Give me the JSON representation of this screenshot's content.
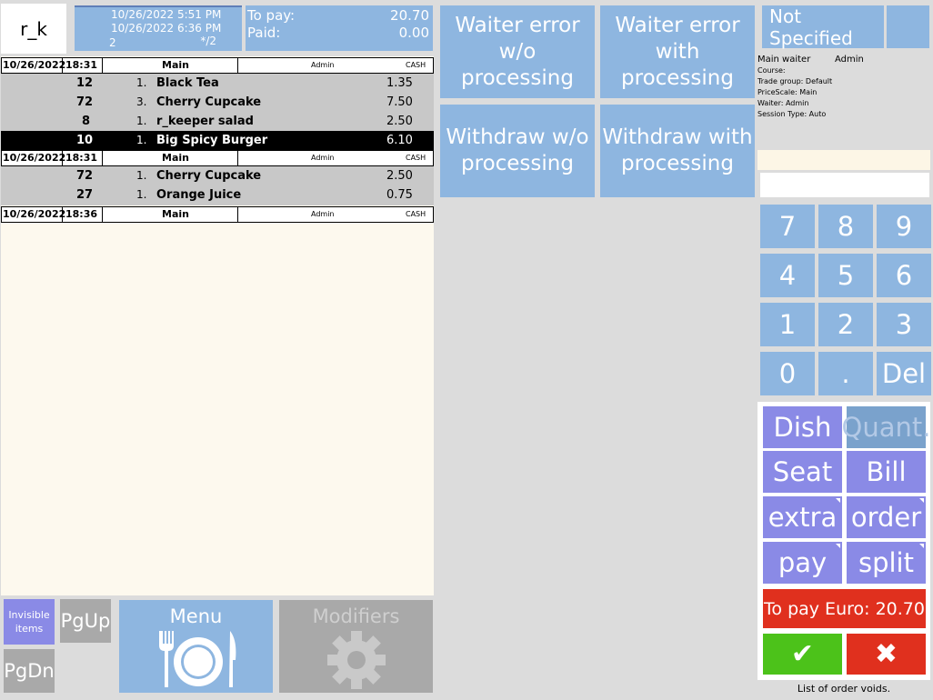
{
  "header": {
    "logo": "r_k",
    "opened": "10/26/2022 5:51 PM",
    "updated": "10/26/2022 6:36 PM",
    "table": "2",
    "guests": "*/2",
    "to_pay_label": "To pay:",
    "to_pay_value": "20.70",
    "paid_label": "Paid:",
    "paid_value": "0.00"
  },
  "order_groups": [
    {
      "date": "10/26/2022",
      "time": "18:31",
      "course": "Main",
      "waiter": "Admin",
      "payment": "CASH",
      "items": [
        {
          "code": "12",
          "qty": "1.",
          "name": "Black Tea",
          "price": "1.35"
        },
        {
          "code": "72",
          "qty": "3.",
          "name": "Cherry Cupcake",
          "price": "7.50"
        },
        {
          "code": "8",
          "qty": "1.",
          "name": "r_keeper salad",
          "price": "2.50"
        },
        {
          "code": "10",
          "qty": "1.",
          "name": "Big Spicy Burger",
          "price": "6.10"
        }
      ]
    },
    {
      "date": "10/26/2022",
      "time": "18:31",
      "course": "Main",
      "waiter": "Admin",
      "payment": "CASH",
      "items": [
        {
          "code": "72",
          "qty": "1.",
          "name": "Cherry Cupcake",
          "price": "2.50"
        },
        {
          "code": "27",
          "qty": "1.",
          "name": "Orange Juice",
          "price": "0.75"
        }
      ]
    },
    {
      "date": "10/26/2022",
      "time": "18:36",
      "course": "Main",
      "waiter": "Admin",
      "payment": "CASH",
      "items": []
    }
  ],
  "bottom_left": {
    "invisible_items": "Invisible items",
    "pgup": "PgUp",
    "pgdn": "PgDn",
    "menu": "Menu",
    "modifiers": "Modifiers"
  },
  "actions": {
    "waiter_error_wo": "Waiter error w/o processing",
    "waiter_error_with": "Waiter error with processing",
    "withdraw_wo": "Withdraw w/o processing",
    "withdraw_with": "Withdraw with processing"
  },
  "right": {
    "not_specified": "Not Specified",
    "main_waiter_label": "Main waiter",
    "main_waiter_value": "Admin",
    "course": "Course:",
    "trade_group": "Trade group: Default",
    "price_scale": "PriceScale: Main",
    "waiter": "Waiter: Admin",
    "session_type": "Session Type: Auto",
    "keypad": [
      "7",
      "8",
      "9",
      "4",
      "5",
      "6",
      "1",
      "2",
      "3",
      "0",
      ".",
      "Del"
    ],
    "dish": "Dish",
    "quant": "Quant.",
    "seat": "Seat",
    "bill": "Bill",
    "extra": "extra",
    "order": "order",
    "pay": "pay",
    "split": "split",
    "to_pay_euro": "To pay Euro: 20.70",
    "ok": "✔",
    "cancel": "✖",
    "footer": "List of order voids."
  },
  "colors": {
    "tile_blue": "#8eb6e0",
    "func_purple": "#8a8ae6",
    "pay_red": "#e0301e",
    "ok_green": "#4cc21a",
    "selected_row": "#000000"
  }
}
